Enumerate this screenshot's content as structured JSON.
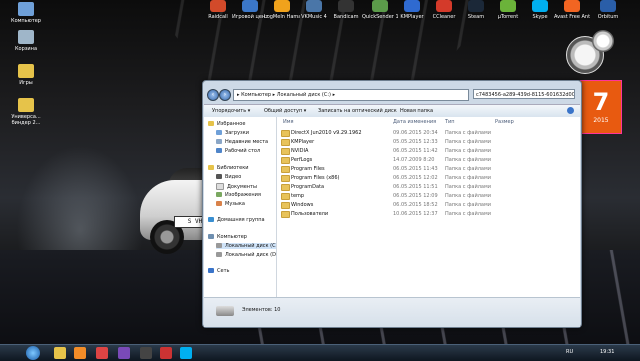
{
  "dock": [
    {
      "label": "Raidcall",
      "color": "#d24a2a"
    },
    {
      "label": "Игровой центр@Ma...",
      "color": "#3b77c8"
    },
    {
      "label": "LogMeIn Hamachi",
      "color": "#f0a21c"
    },
    {
      "label": "VKMusic 4",
      "color": "#4a76a8"
    },
    {
      "label": "Bandicam",
      "color": "#333333"
    },
    {
      "label": "QuickSender 1.9",
      "color": "#5b9b4a"
    },
    {
      "label": "KMPlayer",
      "color": "#2f6ad0"
    },
    {
      "label": "CCleaner",
      "color": "#d43a2a"
    },
    {
      "label": "Steam",
      "color": "#1b2838"
    },
    {
      "label": "µTorrent",
      "color": "#6bb33a"
    },
    {
      "label": "Skype",
      "color": "#00aff0"
    },
    {
      "label": "Avast Free Antivirus",
      "color": "#f26522"
    },
    {
      "label": "Orbitum",
      "color": "#2a5ea8"
    }
  ],
  "desktop_icons": [
    {
      "label": "Компьютер",
      "color": "#6fa0d8"
    },
    {
      "label": "Корзина",
      "color": "#9fb6c9"
    },
    {
      "label": "Игры",
      "color": "#e6c34a"
    },
    {
      "label": "Универса... биндер 2...",
      "color": "#e6c34a"
    }
  ],
  "window": {
    "address": "▸ Компьютер ▸ Локальный диск (C:) ▸",
    "search_value": "c7483456-a289-439d-8115-601632d005a",
    "toolbar": {
      "organize": "Упорядочить ▾",
      "share": "Общий доступ ▾",
      "burn": "Записать на оптический диск",
      "new_folder": "Новая папка"
    },
    "columns": {
      "name": "Имя",
      "date": "Дата изменения",
      "type": "Тип",
      "size": "Размер"
    },
    "nav": {
      "favorites": "Избранное",
      "downloads": "Загрузки",
      "recent": "Недавние места",
      "desktop": "Рабочий стол",
      "libraries": "Библиотеки",
      "video": "Видео",
      "documents": "Документы",
      "images": "Изображения",
      "music": "Музыка",
      "homegroup": "Домашняя группа",
      "computer": "Компьютер",
      "disk_c": "Локальный диск (C",
      "disk_d": "Локальный диск (D",
      "network": "Сеть"
    },
    "rows": [
      {
        "name": "DirectX Jun2010 v9.29.1962",
        "date": "09.06.2015 20:34",
        "type": "Папка с файлами"
      },
      {
        "name": "KMPlayer",
        "date": "05.05.2015 12:33",
        "type": "Папка с файлами"
      },
      {
        "name": "NVIDIA",
        "date": "06.05.2015 11:42",
        "type": "Папка с файлами"
      },
      {
        "name": "PerfLogs",
        "date": "14.07.2009 8:20",
        "type": "Папка с файлами"
      },
      {
        "name": "Program Files",
        "date": "06.05.2015 11:43",
        "type": "Папка с файлами"
      },
      {
        "name": "Program Files (x86)",
        "date": "06.05.2015 12:02",
        "type": "Папка с файлами"
      },
      {
        "name": "ProgramData",
        "date": "06.05.2015 11:51",
        "type": "Папка с файлами"
      },
      {
        "name": "temp",
        "date": "06.05.2015 12:09",
        "type": "Папка с файлами"
      },
      {
        "name": "Windows",
        "date": "06.05.2015 18:52",
        "type": "Папка с файлами"
      },
      {
        "name": "Пользователи",
        "date": "10.06.2015 12:37",
        "type": "Папка с файлами"
      }
    ],
    "status": "Элементов: 10"
  },
  "calendar": {
    "day": "7",
    "year": "2015"
  },
  "plate": "S VH",
  "taskbar": {
    "lang": "RU",
    "time": "19:31",
    "apps": [
      {
        "name": "explorer",
        "color": "#e6c34a"
      },
      {
        "name": "media",
        "color": "#f28c28"
      },
      {
        "name": "chrome",
        "color": "#d44"
      },
      {
        "name": "vs",
        "color": "#7a4ab8"
      },
      {
        "name": "bandicam",
        "color": "#444444"
      },
      {
        "name": "app",
        "color": "#c33"
      },
      {
        "name": "skype",
        "color": "#00aff0"
      }
    ]
  }
}
